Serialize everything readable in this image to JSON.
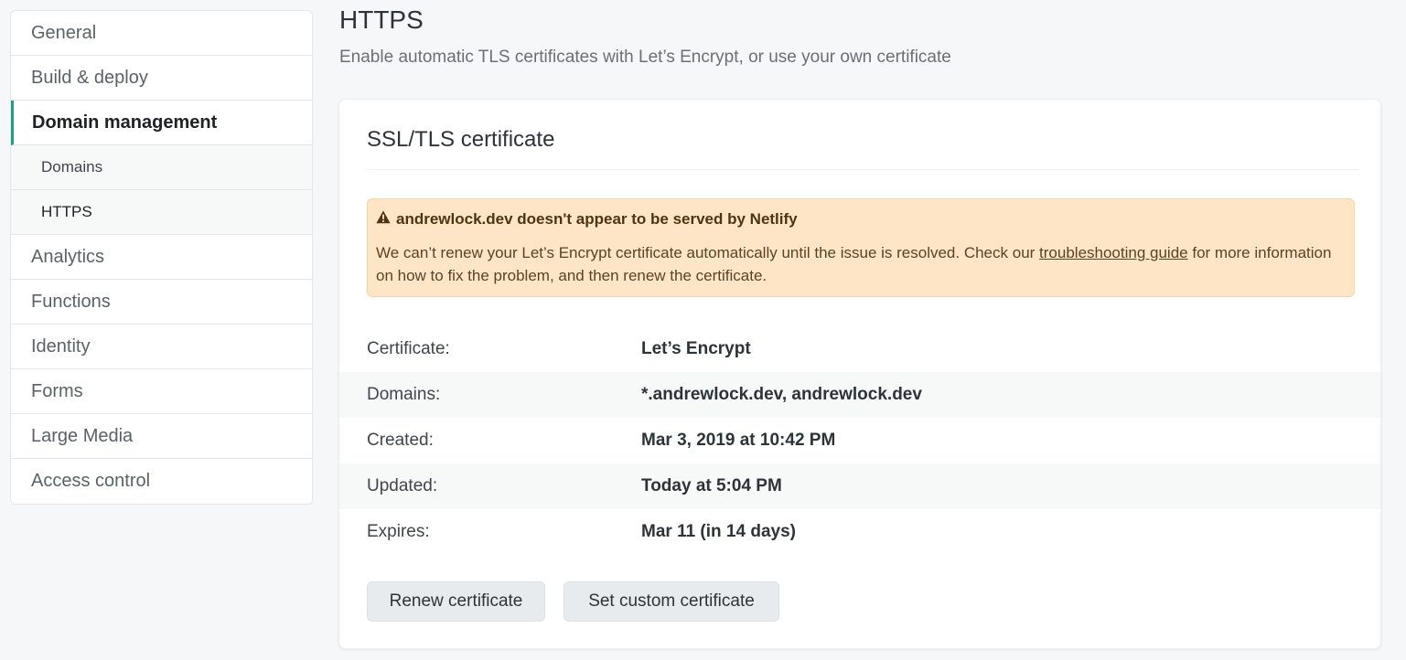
{
  "sidebar": {
    "items": [
      {
        "label": "General"
      },
      {
        "label": "Build & deploy"
      },
      {
        "label": "Domain management"
      },
      {
        "label": "Domains"
      },
      {
        "label": "HTTPS"
      },
      {
        "label": "Analytics"
      },
      {
        "label": "Functions"
      },
      {
        "label": "Identity"
      },
      {
        "label": "Forms"
      },
      {
        "label": "Large Media"
      },
      {
        "label": "Access control"
      }
    ]
  },
  "header": {
    "title": "HTTPS",
    "subtitle": "Enable automatic TLS certificates with Let’s Encrypt, or use your own certificate"
  },
  "card": {
    "title": "SSL/TLS certificate",
    "alert": {
      "icon": "warning-icon",
      "heading": "andrewlock.dev doesn't appear to be served by Netlify",
      "body_before": "We can’t renew your Let’s Encrypt certificate automatically until the issue is resolved. Check our ",
      "link": "troubleshooting guide",
      "body_after": " for more information on how to fix the problem, and then renew the certificate."
    },
    "details": [
      {
        "label": "Certificate:",
        "value": "Let’s Encrypt"
      },
      {
        "label": "Domains:",
        "value": "*.andrewlock.dev, andrewlock.dev"
      },
      {
        "label": "Created:",
        "value": "Mar 3, 2019 at 10:42 PM"
      },
      {
        "label": "Updated:",
        "value": "Today at 5:04 PM"
      },
      {
        "label": "Expires:",
        "value": "Mar 11 (in 14 days)"
      }
    ],
    "buttons": {
      "renew": "Renew certificate",
      "custom": "Set custom certificate"
    }
  },
  "colors": {
    "accent": "#1f9d8a",
    "alert_bg": "#fde5c6"
  }
}
